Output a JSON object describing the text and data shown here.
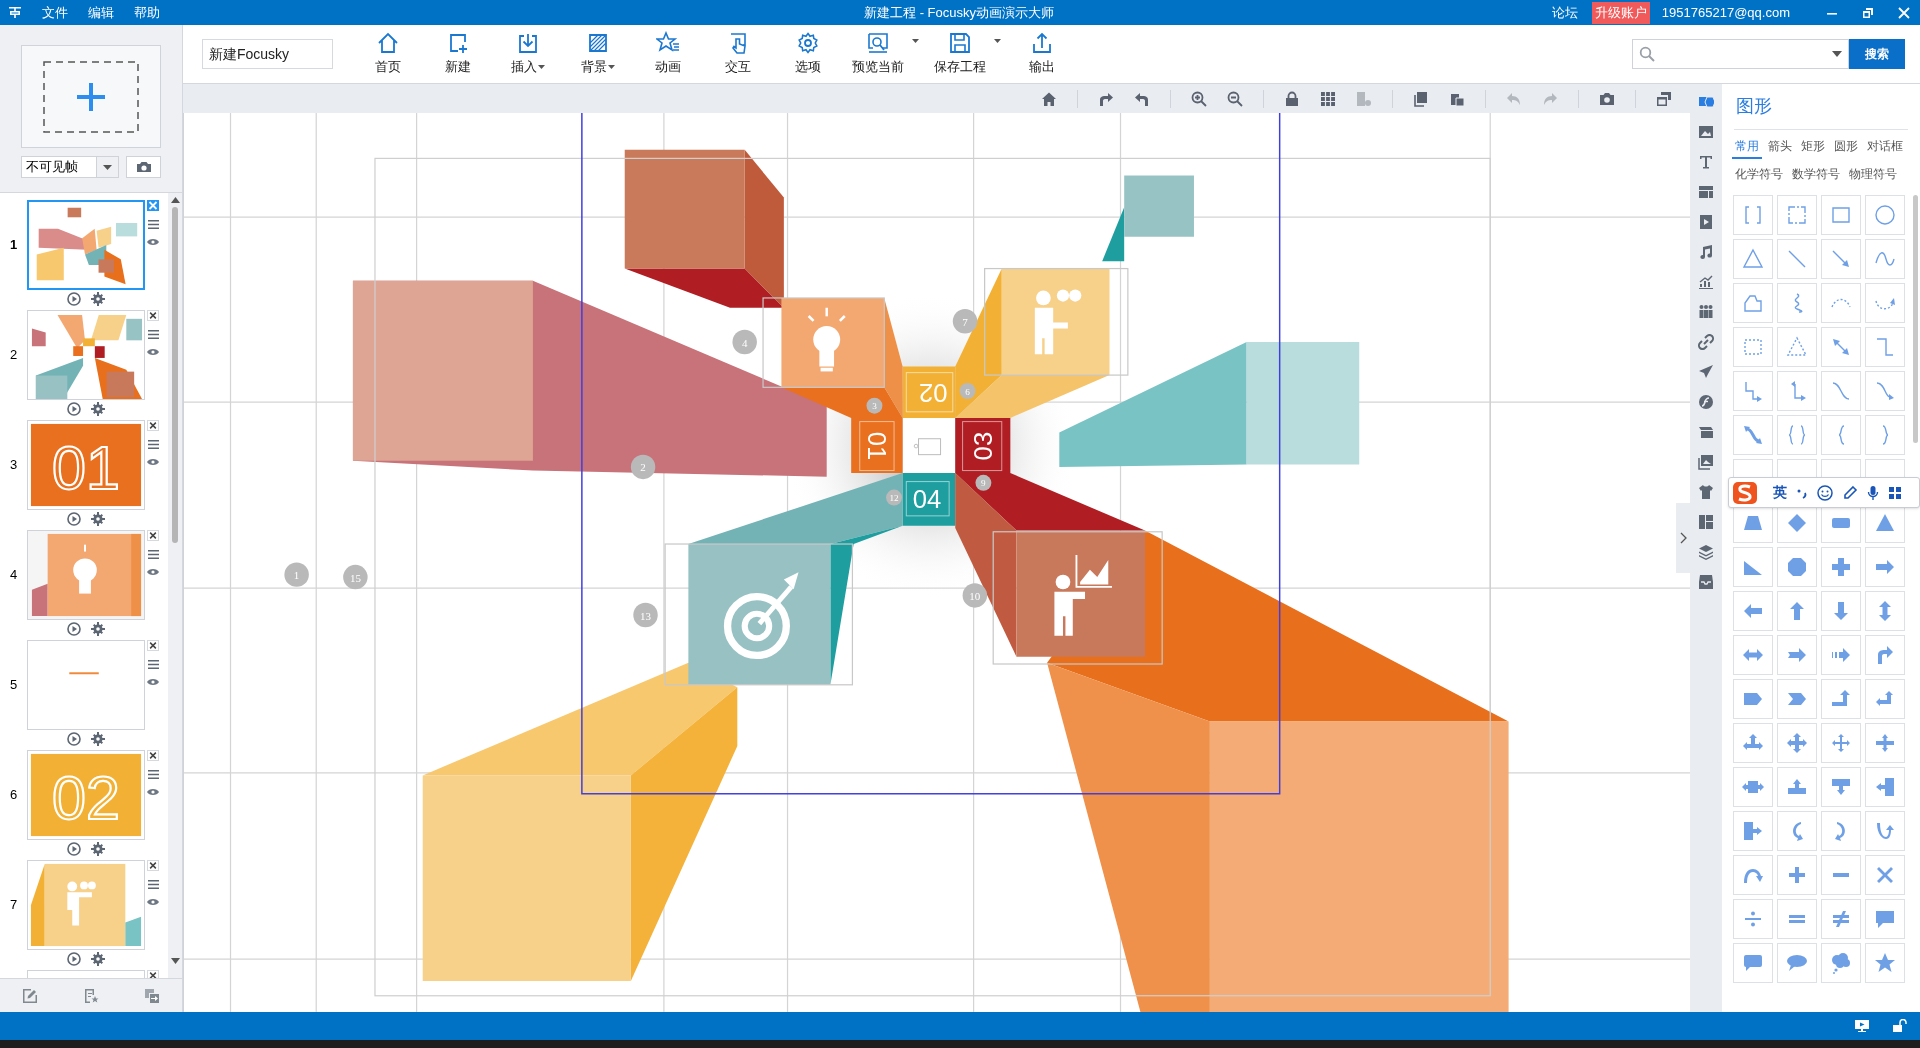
{
  "title_bar": {
    "menus": [
      "文件",
      "编辑",
      "帮助"
    ],
    "title": "新建工程 - Focusky动画演示大师",
    "forum": "论坛",
    "upgrade": "升级账户",
    "account": "1951765217@qq.com"
  },
  "toolbar": {
    "project_name": "新建Focusky",
    "buttons": [
      {
        "label": "首页",
        "kind": "home",
        "dropdown": false
      },
      {
        "label": "新建",
        "kind": "new",
        "dropdown": false
      },
      {
        "label": "插入",
        "kind": "insert",
        "dropdown": true
      },
      {
        "label": "背景",
        "kind": "background",
        "dropdown": true
      },
      {
        "label": "动画",
        "kind": "animation",
        "dropdown": false
      },
      {
        "label": "交互",
        "kind": "interact",
        "dropdown": false
      },
      {
        "label": "选项",
        "kind": "options",
        "dropdown": false
      },
      {
        "label": "预览当前",
        "kind": "preview",
        "dropdown": true
      },
      {
        "label": "保存工程",
        "kind": "save",
        "dropdown": true
      },
      {
        "label": "输出",
        "kind": "export",
        "dropdown": false
      }
    ],
    "search_button": "搜索"
  },
  "frames_panel": {
    "visibility": "不可见帧",
    "frames": [
      {
        "number": "1",
        "selected": true,
        "kind": "overview"
      },
      {
        "number": "2",
        "selected": false,
        "kind": "closeup"
      },
      {
        "number": "3",
        "selected": false,
        "kind": "number",
        "text": "01",
        "color": "#e8701e"
      },
      {
        "number": "4",
        "selected": false,
        "kind": "bulb"
      },
      {
        "number": "5",
        "selected": false,
        "kind": "text"
      },
      {
        "number": "6",
        "selected": false,
        "kind": "number",
        "text": "02",
        "color": "#f2b134"
      },
      {
        "number": "7",
        "selected": false,
        "kind": "binoculars"
      },
      {
        "selected": false,
        "kind": "partial"
      }
    ]
  },
  "canvas": {
    "sections": [
      "01",
      "02",
      "03",
      "04"
    ],
    "path_markers": [
      "1",
      "15",
      "13",
      "2",
      "4",
      "7",
      "10",
      "3",
      "6",
      "9",
      "12"
    ]
  },
  "shapes_panel": {
    "title": "图形",
    "tabs": [
      {
        "label": "常用",
        "selected": true
      },
      {
        "label": "箭头",
        "selected": false
      },
      {
        "label": "矩形",
        "selected": false
      },
      {
        "label": "圆形",
        "selected": false
      },
      {
        "label": "对话框",
        "selected": false
      },
      {
        "label": "化学符号",
        "selected": false
      },
      {
        "label": "数学符号",
        "selected": false
      },
      {
        "label": "物理符号",
        "selected": false
      }
    ]
  },
  "ime_toolbar": {
    "mode": "英"
  }
}
